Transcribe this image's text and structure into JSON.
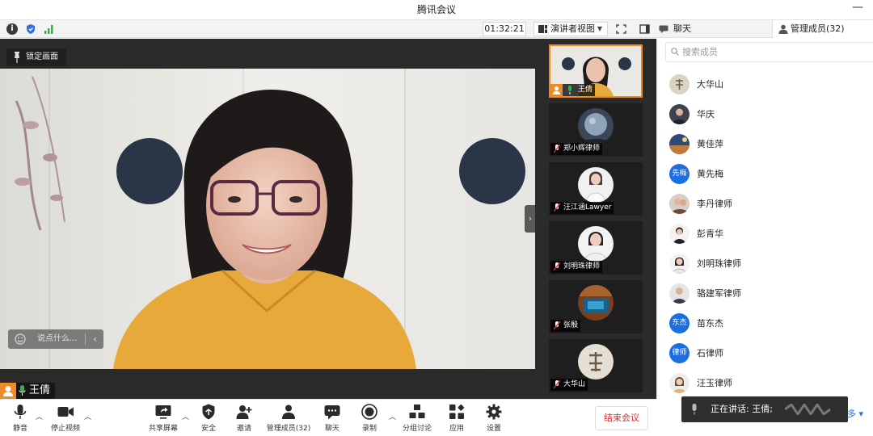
{
  "app": {
    "title": "腾讯会议"
  },
  "topbar": {
    "timer": "01:32:21",
    "view_mode": "演讲者视图",
    "chat_tab": "聊天",
    "members_tab": "管理成员(32)"
  },
  "video": {
    "pin_label": "锁定画面",
    "chat_placeholder": "说点什么...",
    "speaker_name": "王倩"
  },
  "thumbnails": [
    {
      "name": "王倩",
      "active": true
    },
    {
      "name": "郑小辉律师",
      "active": false
    },
    {
      "name": "汪江涵Lawyer",
      "active": false
    },
    {
      "name": "刘明珠律师",
      "active": false
    },
    {
      "name": "张殷",
      "active": false
    },
    {
      "name": "大华山",
      "active": false
    }
  ],
  "members_panel": {
    "search_placeholder": "搜索成员",
    "members": [
      {
        "name": "大华山",
        "avatar_text": ""
      },
      {
        "name": "华庆",
        "avatar_text": ""
      },
      {
        "name": "黄佳萍",
        "avatar_text": ""
      },
      {
        "name": "黄先梅",
        "avatar_text": "先梅"
      },
      {
        "name": "李丹律师",
        "avatar_text": ""
      },
      {
        "name": "彭青华",
        "avatar_text": ""
      },
      {
        "name": "刘明珠律师",
        "avatar_text": ""
      },
      {
        "name": "骆建军律师",
        "avatar_text": ""
      },
      {
        "name": "苗东杰",
        "avatar_text": "东杰"
      },
      {
        "name": "石律师",
        "avatar_text": "律师"
      },
      {
        "name": "汪玉律师",
        "avatar_text": ""
      }
    ],
    "speaking_toast": "正在讲话: 王倩;",
    "more_link": "多"
  },
  "toolbar": {
    "mute": "静音",
    "stop_video": "停止视频",
    "share_screen": "共享屏幕",
    "security": "安全",
    "invite": "邀请",
    "manage_members": "管理成员(32)",
    "chat": "聊天",
    "record": "录制",
    "breakout": "分组讨论",
    "apps": "应用",
    "settings": "设置",
    "end_meeting": "结束会议"
  },
  "colors": {
    "accent": "#f08a24",
    "primary_blue": "#1d6fe0",
    "danger": "#e02b2b"
  }
}
